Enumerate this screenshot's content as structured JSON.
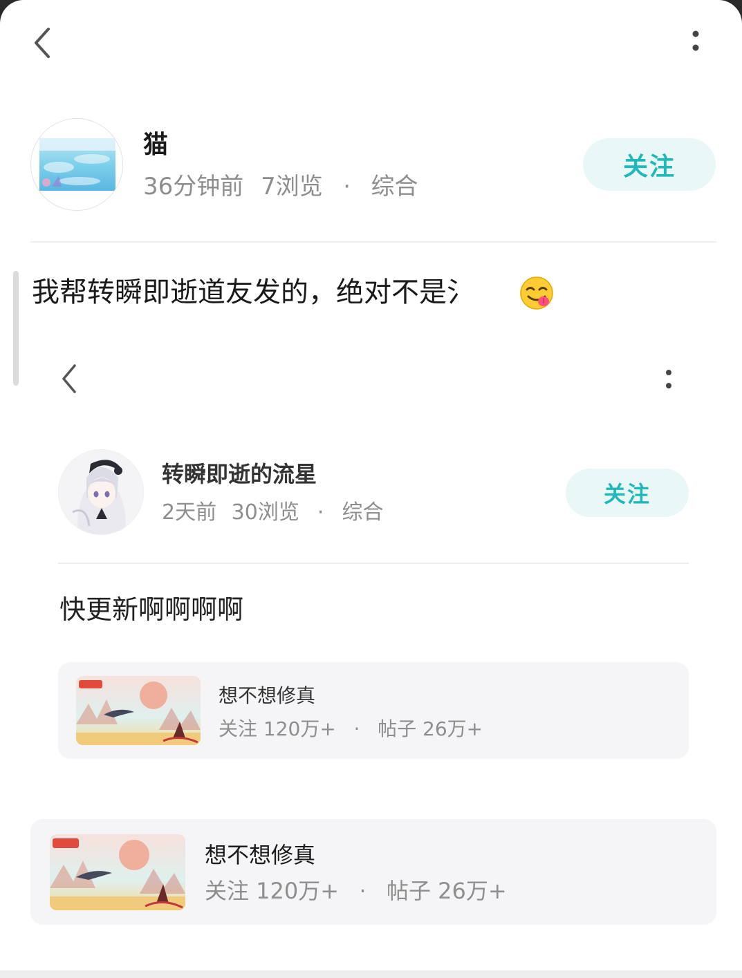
{
  "nav": {
    "back_icon": "chevron-left-icon",
    "more_icon": "vertical-dots-icon"
  },
  "author": {
    "name": "猫",
    "time": "36分钟前",
    "views": "7浏览",
    "category": "综合",
    "follow_label": "关注"
  },
  "post": {
    "text": "我帮转瞬即逝道友发的，绝对不是氵",
    "emoji": "😋"
  },
  "embedded": {
    "author": {
      "name": "转瞬即逝的流星",
      "time": "2天前",
      "views": "30浏览",
      "category": "综合",
      "follow_label": "关注"
    },
    "post_text": "快更新啊啊啊啊",
    "forum_card": {
      "title": "想不想修真",
      "followers": "关注 120万+",
      "posts": "帖子 26万+"
    }
  },
  "forum_card": {
    "title": "想不想修真",
    "followers": "关注 120万+",
    "posts": "帖子 26万+"
  },
  "colors": {
    "accent": "#1fb9b9",
    "follow_bg": "#eaf7f7",
    "meta_gray": "#8e8e8e",
    "card_bg": "#f5f5f7"
  }
}
